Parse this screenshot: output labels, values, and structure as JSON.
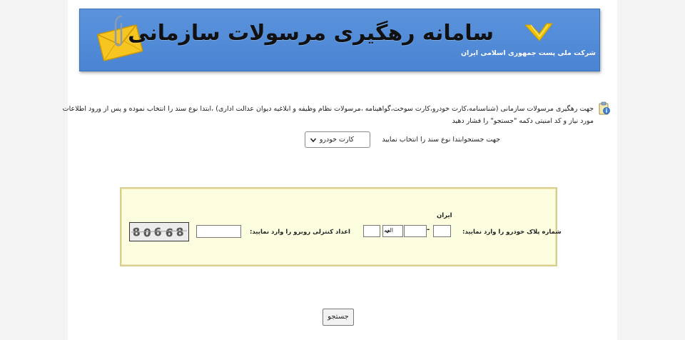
{
  "header": {
    "title": "سامانه رهگیری مرسولات سازمانی",
    "logo_caption": "شرکت ملی پست جمهوری اسلامی ایران"
  },
  "info": {
    "line1": "جهت رهگیری مرسولات سازمانی (شناسنامه،کارت خودرو،کارت سوخت،گواهینامه ،مرسولات نظام وظیفه  و ابلاغیه دیوان عدالت اداری) ،ابتدا  نوع سند را انتخاب نموده و پس از ورود اطلاعات",
    "line2": "مورد نیاز و کد امنیتی دکمه \"جستجو\" را فشار دهید",
    "doc_type_label": "جهت جستجوابتدا نوع سند را انتخاب نمایید",
    "doc_type_value": "کارت خودرو"
  },
  "form": {
    "country_label": "ایران",
    "plate_label": "شماره پلاک خودرو را وارد نمایید:",
    "letter_value": "الف",
    "dash": "-",
    "captcha_label": "اعداد کنترلی روبرو را وارد نمایید:",
    "captcha_text": "80668"
  },
  "actions": {
    "search_label": "جستجو"
  },
  "colors": {
    "banner": "#4a84d2",
    "form_bg": "#fdfde0",
    "form_border": "#d8cf8e",
    "logo": "#f2c300"
  }
}
